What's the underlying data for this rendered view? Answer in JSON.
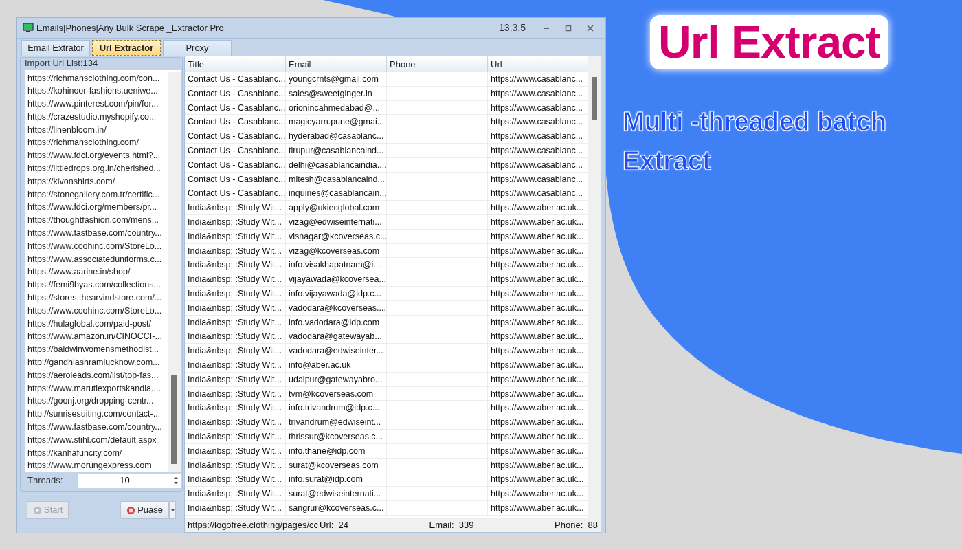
{
  "window": {
    "title": "Emails|Phones|Any Bulk Scrape _Extractor Pro",
    "version": "13.3.5"
  },
  "tabs": [
    {
      "label": "Email Extrator",
      "selected": false
    },
    {
      "label": "Url Extractor",
      "selected": true
    },
    {
      "label": "Proxy",
      "selected": false
    }
  ],
  "url_list": {
    "label": "Import Url List:134",
    "items": [
      "https://richmansclothing.com/con...",
      "https://kohinoor-fashions.ueniwe...",
      "https://www.pinterest.com/pin/for...",
      "https://crazestudio.myshopify.co...",
      "https://linenbloom.in/",
      "https://richmansclothing.com/",
      "https://www.fdci.org/events.html?...",
      "https://littledrops.org.in/cherished...",
      "https://kivonshirts.com/",
      "https://stonegallery.com.tr/certific...",
      "https://www.fdci.org/members/pr...",
      "https://thoughtfashion.com/mens...",
      "https://www.fastbase.com/country...",
      "https://www.coohinc.com/StoreLo...",
      "https://www.associateduniforms.c...",
      "https://www.aarine.in/shop/",
      "https://femi9byas.com/collections...",
      "https://stores.thearvindstore.com/...",
      "https://www.coohinc.com/StoreLo...",
      "https://hulaglobal.com/paid-post/",
      "https://www.amazon.in/CINOCCI-...",
      "https://baldwinwomensmethodist...",
      "http://gandhiashramlucknow.com...",
      "https://aeroleads.com/list/top-fas...",
      "https://www.marutiexportskandla....",
      "https://goonj.org/dropping-centr...",
      "http://sunrisesuiting.com/contact-...",
      "https://www.fastbase.com/country...",
      "https://www.stihl.com/default.aspx",
      "https://kanhafuncity.com/",
      "https://www.morungexpress.com"
    ]
  },
  "threads": {
    "label": "Threads:",
    "value": "10"
  },
  "buttons": [
    {
      "kind": "start",
      "label": "Start",
      "disabled": true
    },
    {
      "kind": "pause",
      "label": "Puase",
      "disabled": false
    }
  ],
  "table": {
    "columns": [
      "Title",
      "Email",
      "Phone",
      "Url"
    ],
    "rows": [
      {
        "title": "Contact Us - Casablanc...",
        "email": "youngcrnts@gmail.com",
        "url": "https://www.casablanc..."
      },
      {
        "title": "Contact Us - Casablanc...",
        "email": "sales@sweetginger.in",
        "url": "https://www.casablanc..."
      },
      {
        "title": "Contact Us - Casablanc...",
        "email": "orionincahmedabad@...",
        "url": "https://www.casablanc..."
      },
      {
        "title": "Contact Us - Casablanc...",
        "email": "magicyarn.pune@gmai...",
        "url": "https://www.casablanc..."
      },
      {
        "title": "Contact Us - Casablanc...",
        "email": "hyderabad@casablanc...",
        "url": "https://www.casablanc..."
      },
      {
        "title": "Contact Us - Casablanc...",
        "email": "tirupur@casablancaind...",
        "url": "https://www.casablanc..."
      },
      {
        "title": "Contact Us - Casablanc...",
        "email": "delhi@casablancaindia....",
        "url": "https://www.casablanc..."
      },
      {
        "title": "Contact Us - Casablanc...",
        "email": "mitesh@casablancaind...",
        "url": "https://www.casablanc..."
      },
      {
        "title": "Contact Us - Casablanc...",
        "email": "inquiries@casablancain...",
        "url": "https://www.casablanc..."
      },
      {
        "title": "India&nbsp; :Study Wit...",
        "email": "apply@ukiecglobal.com",
        "url": "https://www.aber.ac.uk..."
      },
      {
        "title": "India&nbsp; :Study Wit...",
        "email": "vizag@edwiseinternati...",
        "url": "https://www.aber.ac.uk..."
      },
      {
        "title": "India&nbsp; :Study Wit...",
        "email": "visnagar@kcoverseas.c...",
        "url": "https://www.aber.ac.uk..."
      },
      {
        "title": "India&nbsp; :Study Wit...",
        "email": "vizag@kcoverseas.com",
        "url": "https://www.aber.ac.uk..."
      },
      {
        "title": "India&nbsp; :Study Wit...",
        "email": "info.visakhapatnam@i...",
        "url": "https://www.aber.ac.uk..."
      },
      {
        "title": "India&nbsp; :Study Wit...",
        "email": "vijayawada@kcoversea...",
        "url": "https://www.aber.ac.uk..."
      },
      {
        "title": "India&nbsp; :Study Wit...",
        "email": "info.vijayawada@idp.c...",
        "url": "https://www.aber.ac.uk..."
      },
      {
        "title": "India&nbsp; :Study Wit...",
        "email": "vadodara@kcoverseas....",
        "url": "https://www.aber.ac.uk..."
      },
      {
        "title": "India&nbsp; :Study Wit...",
        "email": "info.vadodara@idp.com",
        "url": "https://www.aber.ac.uk..."
      },
      {
        "title": "India&nbsp; :Study Wit...",
        "email": "vadodara@gatewayab...",
        "url": "https://www.aber.ac.uk..."
      },
      {
        "title": "India&nbsp; :Study Wit...",
        "email": "vadodara@edwiseinter...",
        "url": "https://www.aber.ac.uk..."
      },
      {
        "title": "India&nbsp; :Study Wit...",
        "email": "info@aber.ac.uk",
        "url": "https://www.aber.ac.uk..."
      },
      {
        "title": "India&nbsp; :Study Wit...",
        "email": "udaipur@gatewayabro...",
        "url": "https://www.aber.ac.uk..."
      },
      {
        "title": "India&nbsp; :Study Wit...",
        "email": "tvm@kcoverseas.com",
        "url": "https://www.aber.ac.uk..."
      },
      {
        "title": "India&nbsp; :Study Wit...",
        "email": "info.trivandrum@idp.c...",
        "url": "https://www.aber.ac.uk..."
      },
      {
        "title": "India&nbsp; :Study Wit...",
        "email": "trivandrum@edwiseint...",
        "url": "https://www.aber.ac.uk..."
      },
      {
        "title": "India&nbsp; :Study Wit...",
        "email": "thrissur@kcoverseas.c...",
        "url": "https://www.aber.ac.uk..."
      },
      {
        "title": "India&nbsp; :Study Wit...",
        "email": "info.thane@idp.com",
        "url": "https://www.aber.ac.uk..."
      },
      {
        "title": "India&nbsp; :Study Wit...",
        "email": "surat@kcoverseas.com",
        "url": "https://www.aber.ac.uk..."
      },
      {
        "title": "India&nbsp; :Study Wit...",
        "email": "info.surat@idp.com",
        "url": "https://www.aber.ac.uk..."
      },
      {
        "title": "India&nbsp; :Study Wit...",
        "email": "surat@edwiseinternati...",
        "url": "https://www.aber.ac.uk..."
      },
      {
        "title": "India&nbsp; :Study Wit...",
        "email": "sangrur@kcoverseas.c...",
        "url": "https://www.aber.ac.uk..."
      }
    ]
  },
  "status_bar": {
    "current_url": "https://logofree.clothing/pages/cc",
    "counts": [
      {
        "label": "Url:",
        "value": "24"
      },
      {
        "label": "Email:",
        "value": "339"
      },
      {
        "label": "Phone:",
        "value": "88"
      }
    ]
  },
  "banner": {
    "heading": "Url Extract",
    "subheading": "Multi -threaded batch Extract"
  }
}
